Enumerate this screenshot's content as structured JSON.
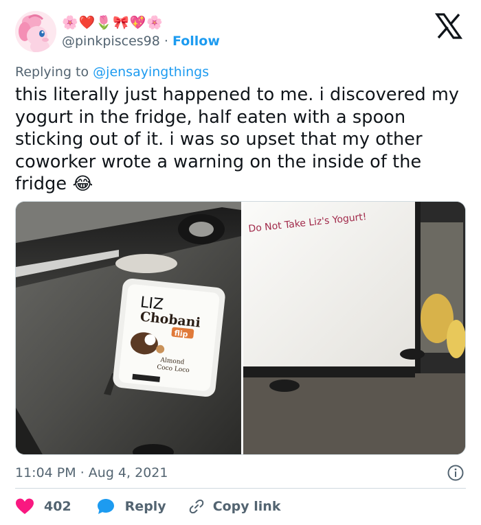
{
  "author": {
    "emojis": [
      "🌸",
      "❤️",
      "🌷",
      "🎀",
      "💖",
      "🌸"
    ],
    "handle": "@pinkpisces98",
    "separator": "·",
    "follow_label": "Follow"
  },
  "reply_context": {
    "prefix": "Replying to",
    "mention": "@jensayingthings"
  },
  "tweet": {
    "text_lines": [
      "this literally just happened to me. i discovered my",
      "yogurt in the fridge, half eaten with a spoon",
      "sticking out of it. i was so upset that my other",
      "coworker wrote a warning on the inside of the",
      "fridge"
    ],
    "emoji": "😂"
  },
  "photos": {
    "left": {
      "lid_name": "LIZ",
      "brand": "Chobani",
      "sub_brand": "flip",
      "flavor_line1": "Almond",
      "flavor_line2": "Coco Loco"
    },
    "right": {
      "note": "Do Not Take Liz's Yogurt!"
    }
  },
  "meta": {
    "time": "11:04 PM",
    "separator": "·",
    "date": "Aug 4, 2021"
  },
  "actions": {
    "like_count": "402",
    "reply_label": "Reply",
    "copy_label": "Copy link"
  },
  "colors": {
    "accent": "#1d9bf0",
    "like": "#f91880",
    "muted": "#536471",
    "text": "#0f1419"
  }
}
